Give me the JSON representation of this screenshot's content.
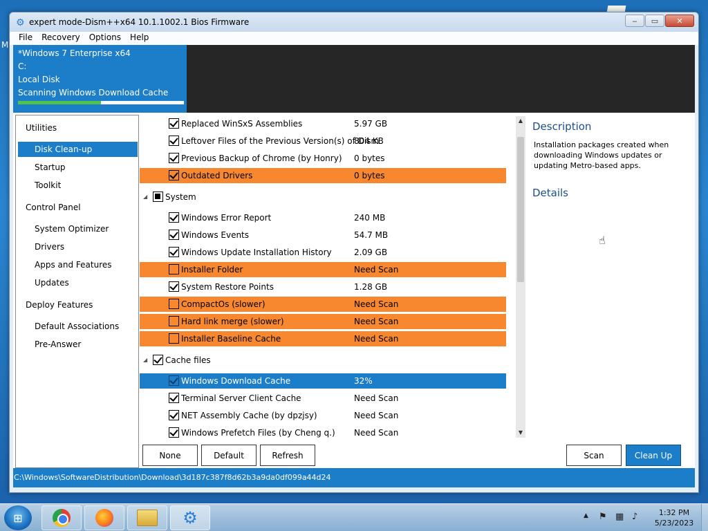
{
  "desktop": {
    "edge_text": "M"
  },
  "window": {
    "title": "expert mode-Dism++x64 10.1.1002.1 Bios Firmware",
    "controls": {
      "minimize": "‒",
      "maximize": "▭",
      "close": "✕"
    }
  },
  "menu": [
    "File",
    "Recovery",
    "Options",
    "Help"
  ],
  "info": {
    "os": "*Windows 7 Enterprise x64",
    "drive": "C:",
    "disk": "Local Disk",
    "status": "Scanning Windows Download Cache",
    "progress_fraction": 0.5
  },
  "sidebar": [
    {
      "label": "Utilities",
      "level": 0
    },
    {
      "label": "Disk Clean-up",
      "level": 1,
      "selected": true
    },
    {
      "label": "Startup",
      "level": 1
    },
    {
      "label": "Toolkit",
      "level": 1
    },
    {
      "label": "Control Panel",
      "level": 0
    },
    {
      "label": "System Optimizer",
      "level": 1
    },
    {
      "label": "Drivers",
      "level": 1
    },
    {
      "label": "Apps and Features",
      "level": 1
    },
    {
      "label": "Updates",
      "level": 1
    },
    {
      "label": "Deploy Features",
      "level": 0
    },
    {
      "label": "Default Associations",
      "level": 1
    },
    {
      "label": "Pre-Answer",
      "level": 1
    }
  ],
  "list": [
    {
      "type": "item",
      "label": "Replaced WinSxS Assemblies",
      "size": "5.97 GB",
      "checked": true
    },
    {
      "type": "item",
      "label": "Leftover Files of the Previous Version(s) of Dism",
      "size": "804 KB",
      "checked": true
    },
    {
      "type": "item",
      "label": "Previous Backup of Chrome (by Honry)",
      "size": "0 bytes",
      "checked": true
    },
    {
      "type": "item",
      "label": "Outdated Drivers",
      "size": "0 bytes",
      "checked": true,
      "highlight": "orange"
    },
    {
      "type": "group",
      "label": "System",
      "state": "indeterminate"
    },
    {
      "type": "item",
      "label": "Windows Error Report",
      "size": "240 MB",
      "checked": true
    },
    {
      "type": "item",
      "label": "Windows Events",
      "size": "54.7 MB",
      "checked": true
    },
    {
      "type": "item",
      "label": "Windows Update Installation History",
      "size": "2.09 GB",
      "checked": true
    },
    {
      "type": "item",
      "label": "Installer Folder",
      "size": "Need Scan",
      "checked": false,
      "highlight": "orange"
    },
    {
      "type": "item",
      "label": "System Restore Points",
      "size": "1.28 GB",
      "checked": true
    },
    {
      "type": "item",
      "label": "CompactOs (slower)",
      "size": "Need Scan",
      "checked": false,
      "highlight": "orange"
    },
    {
      "type": "item",
      "label": "Hard link merge (slower)",
      "size": "Need Scan",
      "checked": false,
      "highlight": "orange"
    },
    {
      "type": "item",
      "label": "Installer Baseline Cache",
      "size": "Need Scan",
      "checked": false,
      "highlight": "orange"
    },
    {
      "type": "group",
      "label": "Cache files",
      "state": "checked"
    },
    {
      "type": "item",
      "label": "Windows Download Cache",
      "size": "32%",
      "checked": true,
      "highlight": "blue"
    },
    {
      "type": "item",
      "label": "Terminal Server Client Cache",
      "size": "Need Scan",
      "checked": true
    },
    {
      "type": "item",
      "label": "NET Assembly Cache (by dpzjsy)",
      "size": "Need Scan",
      "checked": true
    },
    {
      "type": "item",
      "label": "Windows Prefetch Files (by Cheng q.)",
      "size": "Need Scan",
      "checked": true
    }
  ],
  "description": {
    "title": "Description",
    "text": "Installation packages created when downloading Windows updates or updating Metro-based apps.",
    "details_title": "Details"
  },
  "buttons": {
    "none": "None",
    "default": "Default",
    "refresh": "Refresh",
    "scan": "Scan",
    "clean_up": "Clean Up"
  },
  "status_path": "C:\\Windows\\SoftwareDistribution\\Download\\3d187c387f8d62b3a9da0df099a44d24",
  "taskbar": {
    "time": "1:32 PM",
    "date": "5/23/2023"
  },
  "colors": {
    "accent": "#1c7ec8",
    "warning_row": "#f7882f",
    "progress": "#51c24a",
    "header_dark": "#262626"
  }
}
